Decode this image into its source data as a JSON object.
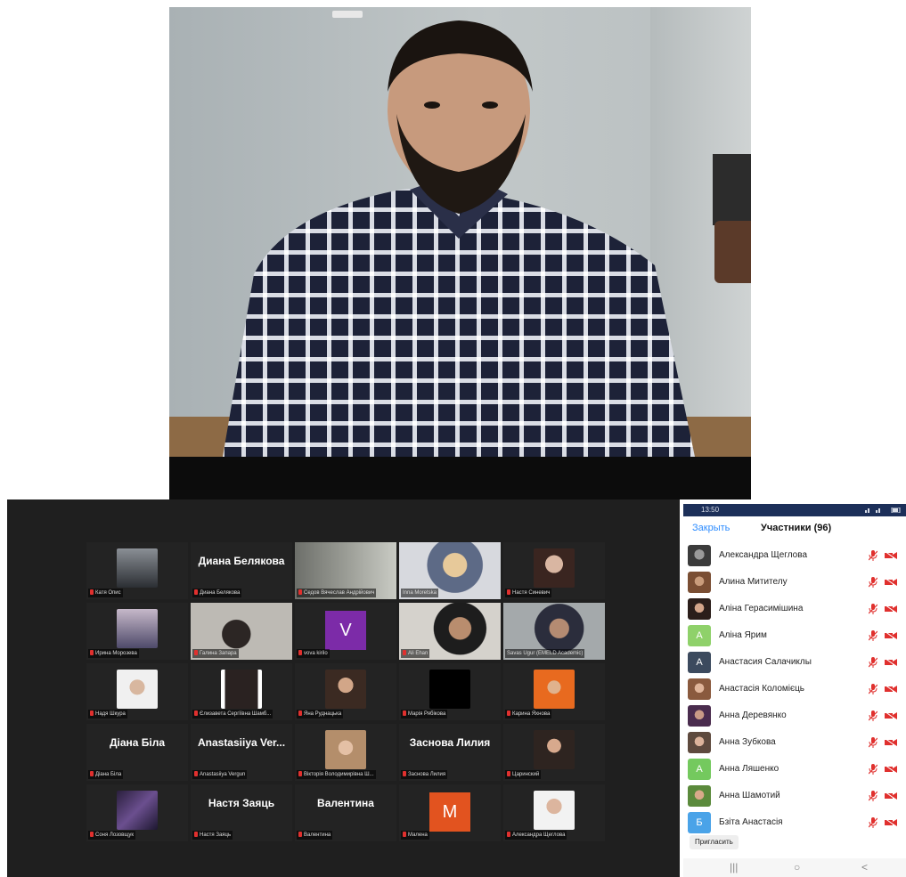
{
  "gallery": {
    "tiles": [
      {
        "name": "Катя Опис",
        "display": ""
      },
      {
        "name": "Диана Белякова",
        "display": "Диана Белякова"
      },
      {
        "name": "Седов Вячеслав Андрійович",
        "display": ""
      },
      {
        "name": "Inna Moretska",
        "display": ""
      },
      {
        "name": "Настя Синевич",
        "display": ""
      },
      {
        "name": "Ирина Морозева",
        "display": ""
      },
      {
        "name": "Галина Запара",
        "display": ""
      },
      {
        "name": "vova kirilo",
        "display": "",
        "letter": "V"
      },
      {
        "name": "Ali Ehan",
        "display": ""
      },
      {
        "name": "Savas Ugur (EMELD Academic)",
        "display": ""
      },
      {
        "name": "Надя Шкура",
        "display": ""
      },
      {
        "name": "Єлизавета Сергіївна Шамб...",
        "display": ""
      },
      {
        "name": "Яна Руднацька",
        "display": ""
      },
      {
        "name": "Марія Рябікова",
        "display": ""
      },
      {
        "name": "Карина Яхнова",
        "display": ""
      },
      {
        "name": "Діана Біла",
        "display": "Діана Біла"
      },
      {
        "name": "Anastasiiya Vergun",
        "display": "Anastasiiya Ver..."
      },
      {
        "name": "Вікторія Володимирівна Ш...",
        "display": ""
      },
      {
        "name": "Заснова Лилия",
        "display": "Заснова Лилия"
      },
      {
        "name": "Царинский",
        "display": ""
      },
      {
        "name": "Соня Лозовщук",
        "display": ""
      },
      {
        "name": "Настя Заяць",
        "display": "Настя Заяць"
      },
      {
        "name": "Валентина",
        "display": "Валентина"
      },
      {
        "name": "Малена",
        "display": "",
        "letter": "M"
      },
      {
        "name": "Александра Щеглова",
        "display": ""
      }
    ]
  },
  "phone": {
    "status_time": "13:50",
    "close_label": "Закрыть",
    "title": "Участники (96)",
    "participants": [
      {
        "name": "Александра Щеглова",
        "initial": ""
      },
      {
        "name": "Алина Митителу",
        "initial": ""
      },
      {
        "name": "Аліна Герасимішина",
        "initial": ""
      },
      {
        "name": "Аліна Ярим",
        "initial": "А"
      },
      {
        "name": "Анастасия Салачиклы",
        "initial": "А"
      },
      {
        "name": "Анастасія Коломієць",
        "initial": ""
      },
      {
        "name": "Анна Деревянко",
        "initial": ""
      },
      {
        "name": "Анна Зубкова",
        "initial": ""
      },
      {
        "name": "Анна Ляшенко",
        "initial": "А"
      },
      {
        "name": "Анна Шамотий",
        "initial": ""
      },
      {
        "name": "Бзіта Анастасія",
        "initial": "Б"
      }
    ],
    "invite_label": "Пригласить",
    "nav": [
      "|||",
      "○",
      "<"
    ]
  },
  "colors": {
    "zoom_blue": "#2d8cff",
    "muted_red": "#e0302e",
    "speaker_border": "#b7d96a",
    "gallery_bg": "#1f1f1f",
    "status_bar": "#1c2f59"
  }
}
